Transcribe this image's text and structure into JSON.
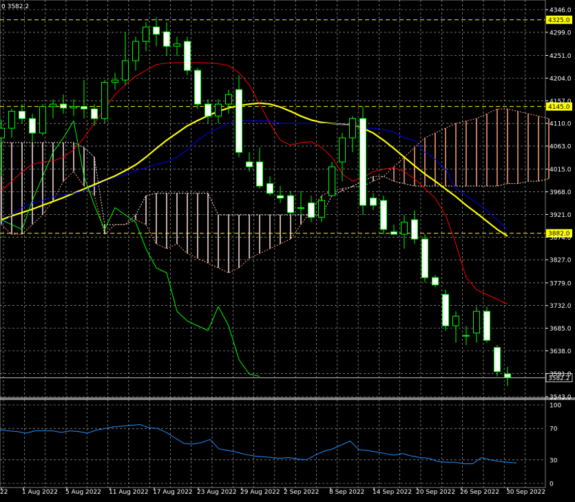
{
  "symbol_label": "0 3582.2",
  "colors": {
    "background": "#000000",
    "grid": "#c0c0c0",
    "bull_candle": "#000000",
    "bear_candle": "#ffffff",
    "candle_outline": "#00ff00",
    "ma_yellow": "#ffff00",
    "tenkan_red": "#ff0000",
    "kijun_blue": "#0000ff",
    "chikou_green": "#00ff00",
    "cloud_bull": "#ffa07a",
    "cloud_bear": "#ffe4e1",
    "oscillator": "#1e90ff",
    "level_line": "#ffff00"
  },
  "chart_data": [
    {
      "type": "candlestick",
      "title": "",
      "ylim": [
        3543.0,
        4346.0
      ],
      "price_ticks": [
        "4346.0",
        "4299.0",
        "4251.0",
        "4204.0",
        "4157.0",
        "4110.0",
        "4063.0",
        "4015.0",
        "3968.0",
        "3921.0",
        "3874.0",
        "3827.0",
        "3779.0",
        "3732.0",
        "3685.0",
        "3638.0",
        "3591.0",
        "3543.0"
      ],
      "date_labels": [
        "22",
        "1 Aug 2022",
        "5 Aug 2022",
        "11 Aug 2022",
        "17 Aug 2022",
        "23 Aug 2022",
        "29 Aug 2022",
        "2 Sep 2022",
        "8 Sep 2022",
        "14 Sep 2022",
        "20 Sep 2022",
        "26 Sep 2022",
        "30 Sep 2022"
      ],
      "level_lines": [
        {
          "value": 4325.0,
          "label": "4325.0"
        },
        {
          "value": 4145.0,
          "label": "4145.0"
        },
        {
          "value": 3882.0,
          "label": "3882.0"
        }
      ],
      "current_price": {
        "value": 3582.2,
        "label": "3582.2"
      },
      "candles": [
        [
          4080,
          4118,
          4000,
          4100
        ],
        [
          4100,
          4140,
          4080,
          4135
        ],
        [
          4135,
          4150,
          4110,
          4120
        ],
        [
          4120,
          4130,
          4070,
          4090
        ],
        [
          4090,
          4150,
          4085,
          4145
        ],
        [
          4145,
          4160,
          4120,
          4150
        ],
        [
          4150,
          4170,
          4130,
          4142
        ],
        [
          4142,
          4160,
          4125,
          4145
        ],
        [
          4145,
          4200,
          4120,
          4140
        ],
        [
          4140,
          4150,
          4105,
          4120
        ],
        [
          4120,
          4200,
          4110,
          4195
        ],
        [
          4195,
          4215,
          4180,
          4200
        ],
        [
          4200,
          4300,
          4190,
          4240
        ],
        [
          4240,
          4290,
          4220,
          4280
        ],
        [
          4280,
          4320,
          4260,
          4310
        ],
        [
          4310,
          4330,
          4270,
          4295
        ],
        [
          4300,
          4320,
          4250,
          4270
        ],
        [
          4270,
          4290,
          4250,
          4275
        ],
        [
          4280,
          4290,
          4210,
          4220
        ],
        [
          4220,
          4225,
          4140,
          4150
        ],
        [
          4150,
          4160,
          4110,
          4125
        ],
        [
          4125,
          4160,
          4110,
          4150
        ],
        [
          4150,
          4180,
          4130,
          4170
        ],
        [
          4180,
          4210,
          4040,
          4050
        ],
        [
          4030,
          4050,
          4010,
          4020
        ],
        [
          4030,
          4060,
          3975,
          3980
        ],
        [
          3985,
          4000,
          3960,
          3965
        ],
        [
          3960,
          3980,
          3945,
          3955
        ],
        [
          3960,
          3970,
          3920,
          3925
        ],
        [
          3935,
          3970,
          3920,
          3935
        ],
        [
          3945,
          3960,
          3905,
          3915
        ],
        [
          3915,
          3960,
          3905,
          3950
        ],
        [
          3960,
          4030,
          3960,
          4020
        ],
        [
          4030,
          4090,
          3990,
          4080
        ],
        [
          4080,
          4125,
          4050,
          4120
        ],
        [
          4120,
          4145,
          3920,
          3940
        ],
        [
          3955,
          3965,
          3930,
          3940
        ],
        [
          3950,
          3960,
          3880,
          3890
        ],
        [
          3885,
          3900,
          3880,
          3880
        ],
        [
          3880,
          3920,
          3850,
          3905
        ],
        [
          3910,
          3930,
          3860,
          3870
        ],
        [
          3870,
          3880,
          3780,
          3790
        ],
        [
          3790,
          3795,
          3770,
          3775
        ],
        [
          3755,
          3765,
          3680,
          3690
        ],
        [
          3690,
          3720,
          3655,
          3710
        ],
        [
          3670,
          3690,
          3650,
          3670
        ],
        [
          3675,
          3730,
          3655,
          3720
        ],
        [
          3720,
          3730,
          3655,
          3660
        ],
        [
          3645,
          3650,
          3585,
          3595
        ],
        [
          3590,
          3605,
          3565,
          3583
        ]
      ],
      "series": [
        {
          "name": "",
          "color": "#ffff00",
          "values": [
            3910,
            3918,
            3925,
            3932,
            3940,
            3948,
            3956,
            3965,
            3974,
            3983,
            3992,
            4001,
            4012,
            4024,
            4040,
            4058,
            4075,
            4090,
            4105,
            4116,
            4126,
            4135,
            4142,
            4147,
            4150,
            4152,
            4150,
            4144,
            4135,
            4125,
            4117,
            4112,
            4110,
            4108,
            4106,
            4100,
            4090,
            4075,
            4058,
            4040,
            4022,
            4005,
            3990,
            3974,
            3958,
            3940,
            3924,
            3907,
            3890,
            3876
          ]
        },
        {
          "name": "",
          "color": "#ff0000",
          "values": [
            3970,
            3990,
            4010,
            4025,
            4030,
            4032,
            4040,
            4055,
            4080,
            4110,
            4140,
            4170,
            4190,
            4208,
            4220,
            4232,
            4235,
            4236,
            4236,
            4236,
            4235,
            4234,
            4230,
            4215,
            4190,
            4150,
            4110,
            4075,
            4065,
            4070,
            4072,
            4060,
            4040,
            4005,
            3990,
            3998,
            4010,
            4015,
            4018,
            4010,
            3995,
            3975,
            3955,
            3920,
            3860,
            3790,
            3765,
            3755,
            3745,
            3735
          ]
        },
        {
          "name": "",
          "color": "#0000ff",
          "values": [
            3900,
            3920,
            3935,
            3945,
            3950,
            3958,
            3962,
            3965,
            3970,
            3980,
            3990,
            3998,
            4004,
            4012,
            4018,
            4025,
            4030,
            4040,
            4055,
            4075,
            4090,
            4100,
            4110,
            4115,
            4115,
            4115,
            4115,
            4110,
            4110,
            4110,
            4110,
            4110,
            4110,
            4108,
            4105,
            4100,
            4100,
            4097,
            4092,
            4080,
            4075,
            4050,
            4035,
            4015,
            3975,
            3960,
            3945,
            3930,
            3910,
            3890
          ]
        },
        {
          "name": "",
          "color": "#00ff00",
          "values": [
            3910,
            3900,
            3890,
            3950,
            4000,
            4050,
            4080,
            4115,
            4000,
            3940,
            3890,
            3935,
            3920,
            3905,
            3850,
            3810,
            3800,
            3720,
            3700,
            3690,
            3680,
            3730,
            3690,
            3620,
            3590,
            3585
          ]
        }
      ],
      "cloud": {
        "span_a": [
          3900,
          3880,
          3880,
          3900,
          3920,
          3950,
          3990,
          4010,
          3980,
          3960,
          3880,
          3900,
          3900,
          3910,
          3900,
          3860,
          3850,
          3860,
          3840,
          3830,
          3820,
          3810,
          3800,
          3810,
          3830,
          3840,
          3850,
          3860,
          3870,
          3900,
          3930,
          3960,
          3970,
          3975,
          3978,
          3980,
          3990,
          4000,
          4020,
          4040,
          4060,
          4080,
          4090,
          4100,
          4110,
          4115,
          4120,
          4130,
          4140,
          4140,
          4135,
          4130,
          4125,
          4120
        ],
        "span_b": [
          4070,
          4070,
          4070,
          4070,
          4070,
          4070,
          4070,
          4070,
          4060,
          4040,
          3900,
          3900,
          3900,
          3920,
          3960,
          3965,
          3965,
          3965,
          3965,
          3965,
          3965,
          3920,
          3920,
          3920,
          3920,
          3920,
          3920,
          3920,
          3920,
          3920,
          3920,
          3920,
          3960,
          3970,
          3980,
          3990,
          4000,
          4000,
          3990,
          3985,
          3980,
          3980,
          3980,
          3980,
          3980,
          3980,
          3980,
          3980,
          3980,
          3985,
          3985,
          3990,
          3990,
          3995
        ]
      }
    },
    {
      "type": "line",
      "title": "",
      "ylim": [
        0,
        100
      ],
      "y_ticks": [
        "100",
        "70",
        "30",
        "0"
      ],
      "series": [
        {
          "name": "",
          "color": "#1e90ff",
          "values": [
            68,
            67,
            66,
            64,
            67,
            67,
            67,
            65,
            67,
            66,
            64,
            68,
            70,
            72,
            73,
            74,
            75,
            71,
            70,
            65,
            58,
            51,
            50,
            52,
            56,
            44,
            42,
            40,
            37,
            35,
            34,
            33,
            32,
            33,
            31,
            30,
            36,
            41,
            44,
            49,
            54,
            43,
            42,
            40,
            38,
            36,
            38,
            35,
            33,
            32,
            28,
            27,
            27,
            25,
            25,
            33,
            30,
            28,
            27,
            26
          ]
        }
      ]
    }
  ]
}
